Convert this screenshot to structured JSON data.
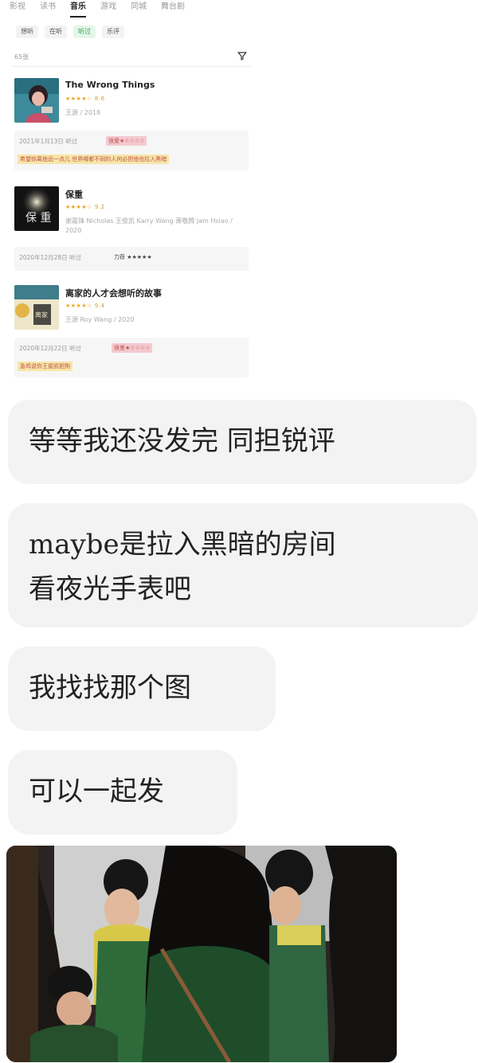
{
  "douban_screenshot": {
    "top_tabs": [
      "影视",
      "读书",
      "音乐",
      "游戏",
      "同城",
      "舞台剧"
    ],
    "active_top_tab": "音乐",
    "sub_tabs": [
      "想听",
      "在听",
      "听过",
      "乐评"
    ],
    "active_sub_tab": "听过",
    "count_label": "65张",
    "records": [
      {
        "title": "The Wrong Things",
        "stars": "★★★★☆",
        "score": "8.6",
        "meta": "王源 / 2018",
        "date": "2021年1月13日 听过",
        "tag": "很爱★☆☆☆☆",
        "comment": "希望你离他远一点儿 世界哪都不同的人何必把他也拉入黑暗"
      },
      {
        "title": "保重",
        "stars": "★★★★☆",
        "score": "9.2",
        "meta": "谢霆锋 Nicholas 王俊凯 Karry Wang 萧敬腾 Jam Hsiao / 2020",
        "date": "2020年12月28日 听过",
        "tag": "力荐 ★★★★★",
        "comment": ""
      },
      {
        "title": "离家的人才会想听的故事",
        "stars": "★★★★☆",
        "score": "9.4",
        "meta": "王源 Roy Wang / 2020",
        "date": "2020年12月22日 听过",
        "tag": "很差★☆☆☆☆",
        "comment": "急鸡说你王俊凯胆狗"
      }
    ]
  },
  "messages": [
    {
      "text": "等等我还没发完 同担锐评"
    },
    {
      "lines": [
        "maybe是拉入黑暗的房间",
        "看夜光手表吧"
      ]
    },
    {
      "text": "我找找那个图"
    },
    {
      "text": "可以一起发"
    }
  ],
  "colors": {
    "bubble_bg": "#f3f3f3",
    "accent_green": "#2fa44f",
    "star_orange": "#f0a020",
    "tag_pink": "#f3c9cf",
    "highlight_yellow": "#f7e6a6"
  }
}
